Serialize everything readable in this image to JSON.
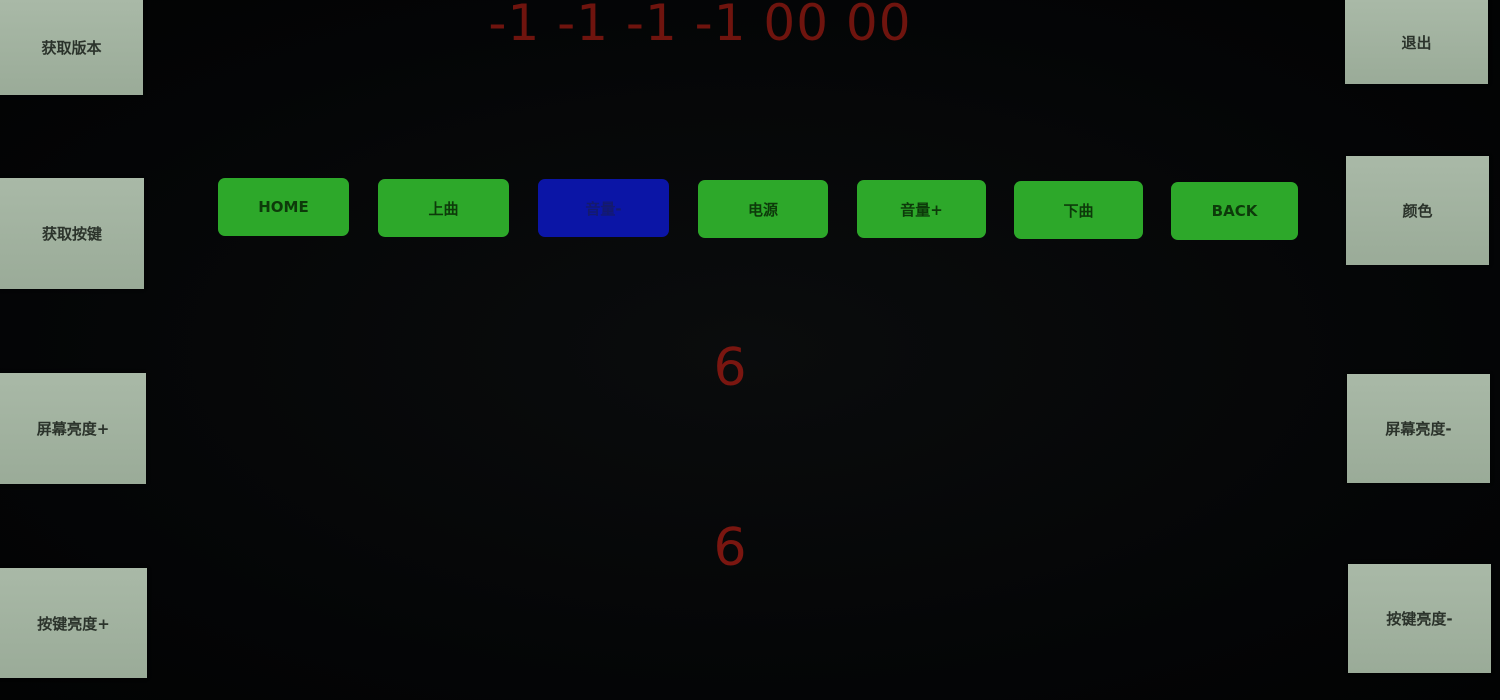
{
  "status_line": "-1 -1 -1 -1 00 00",
  "left_buttons": [
    {
      "label": "获取版本"
    },
    {
      "label": "获取按键"
    },
    {
      "label": "屏幕亮度+"
    },
    {
      "label": "按键亮度+"
    }
  ],
  "right_buttons": [
    {
      "label": "退出"
    },
    {
      "label": "颜色"
    },
    {
      "label": "屏幕亮度-"
    },
    {
      "label": "按键亮度-"
    }
  ],
  "keys": [
    {
      "label": "HOME",
      "state": "normal"
    },
    {
      "label": "上曲",
      "state": "normal"
    },
    {
      "label": "音量-",
      "state": "active"
    },
    {
      "label": "电源",
      "state": "normal"
    },
    {
      "label": "音量+",
      "state": "normal"
    },
    {
      "label": "下曲",
      "state": "normal"
    },
    {
      "label": "BACK",
      "state": "normal"
    }
  ],
  "readouts": {
    "value_1": "6",
    "value_2": "6"
  },
  "colors": {
    "key_normal": "#2ea82a",
    "key_active": "#0c16a8",
    "side_button": "#a3b3a1",
    "readout_text": "#7a1610"
  }
}
